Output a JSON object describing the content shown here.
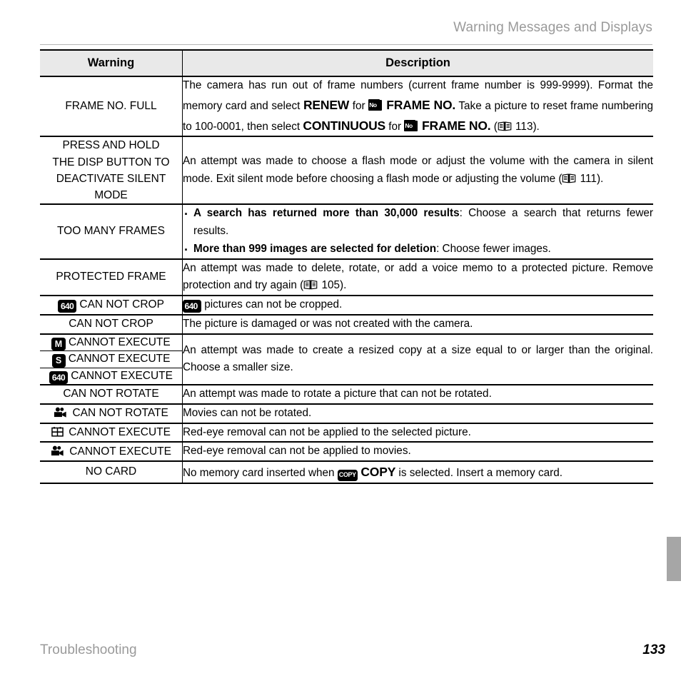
{
  "header": {
    "running_title": "Warning Messages and Displays"
  },
  "table": {
    "columns": {
      "warning": "Warning",
      "description": "Description"
    },
    "rows": [
      {
        "warning": "FRAME NO. FULL",
        "desc_parts": [
          {
            "t": "The camera has run out of frame numbers (current frame number is 999-9999).  Format the memory card and select "
          },
          {
            "t": "RENEW",
            "style": "big-bold"
          },
          {
            "t": " for "
          },
          {
            "icon": "frame-no-icon",
            "label": "No"
          },
          {
            "t": " FRAME NO.",
            "style": "big-bold"
          },
          {
            "t": " Take a picture to reset frame numbering to 100-0001, then select "
          },
          {
            "t": "CONTINUOUS",
            "style": "big-bold"
          },
          {
            "t": " for "
          },
          {
            "icon": "frame-no-icon",
            "label": "No"
          },
          {
            "t": " FRAME NO.",
            "style": "big-bold"
          },
          {
            "t": " ("
          },
          {
            "icon": "book-icon"
          },
          {
            "t": " 113)."
          }
        ]
      },
      {
        "warning": "PRESS AND HOLD\nTHE DISP BUTTON TO\nDEACTIVATE SILENT MODE",
        "desc_parts": [
          {
            "t": "An attempt was made to choose a flash mode or adjust the volume with the camera in silent mode.  Exit silent mode before choosing a flash mode or adjusting the volume ("
          },
          {
            "icon": "book-icon"
          },
          {
            "t": " 111)."
          }
        ]
      },
      {
        "warning": "TOO MANY FRAMES",
        "bullets": [
          [
            {
              "t": "A search has returned more than 30,000 results",
              "style": "b"
            },
            {
              "t": ": Choose a search that returns fewer results."
            }
          ],
          [
            {
              "t": " More than 999 images are selected for deletion",
              "style": "b"
            },
            {
              "t": ":  Choose fewer images."
            }
          ]
        ]
      },
      {
        "warning": "PROTECTED FRAME",
        "desc_parts": [
          {
            "t": "An attempt was made to delete, rotate, or add a voice memo to a protected picture.  Remove protection and try again ("
          },
          {
            "icon": "book-icon"
          },
          {
            "t": " 105)."
          }
        ]
      },
      {
        "warning_parts": [
          {
            "icon": "badge-640",
            "label": "640"
          },
          {
            "t": " CAN NOT CROP"
          }
        ],
        "desc_parts": [
          {
            "icon": "badge-640",
            "label": "640"
          },
          {
            "t": " pictures can not be cropped."
          }
        ]
      },
      {
        "warning": "CAN NOT CROP",
        "desc_parts": [
          {
            "t": "The picture is damaged or was not created with the camera."
          }
        ]
      },
      {
        "warning_parts": [
          {
            "icon": "badge-m",
            "label": "M"
          },
          {
            "t": " CANNOT EXECUTE"
          }
        ],
        "merged_desc_parts": [
          {
            "t": "An attempt was made to create a resized copy at a size equal to or larger than the original.  Choose a smaller size."
          }
        ]
      },
      {
        "warning_parts": [
          {
            "icon": "badge-s",
            "label": "S"
          },
          {
            "t": " CANNOT EXECUTE"
          }
        ]
      },
      {
        "warning_parts": [
          {
            "icon": "badge-640",
            "label": "640"
          },
          {
            "t": " CANNOT EXECUTE"
          }
        ]
      },
      {
        "warning": "CAN NOT ROTATE",
        "desc_parts": [
          {
            "t": "An attempt was made to rotate a picture that can not be rotated."
          }
        ]
      },
      {
        "warning_parts": [
          {
            "icon": "movie-camera-icon"
          },
          {
            "t": " CAN NOT ROTATE"
          }
        ],
        "desc_parts": [
          {
            "t": "Movies can not be rotated."
          }
        ]
      },
      {
        "warning_parts": [
          {
            "icon": "multi-frame-icon"
          },
          {
            "t": " CANNOT EXECUTE"
          }
        ],
        "desc_parts": [
          {
            "t": "Red-eye removal can not be applied to the selected picture."
          }
        ]
      },
      {
        "warning_parts": [
          {
            "icon": "movie-camera-icon"
          },
          {
            "t": " CANNOT EXECUTE"
          }
        ],
        "desc_parts": [
          {
            "t": "Red-eye removal can not be applied to movies."
          }
        ]
      },
      {
        "warning": "NO CARD",
        "desc_parts": [
          {
            "t": "No memory card inserted when "
          },
          {
            "icon": "badge-copy",
            "label": "COPY"
          },
          {
            "t": " COPY",
            "style": "big-bold"
          },
          {
            "t": " is selected.  Insert a memory card."
          }
        ]
      }
    ]
  },
  "footer": {
    "section": "Troubleshooting",
    "page_number": "133"
  },
  "colors": {
    "header_text": "#9a9a9a",
    "rule": "#b5b5b5",
    "table_header_bg": "#e9e9e9",
    "edge_tab": "#a6a6a6",
    "ink": "#000000"
  }
}
